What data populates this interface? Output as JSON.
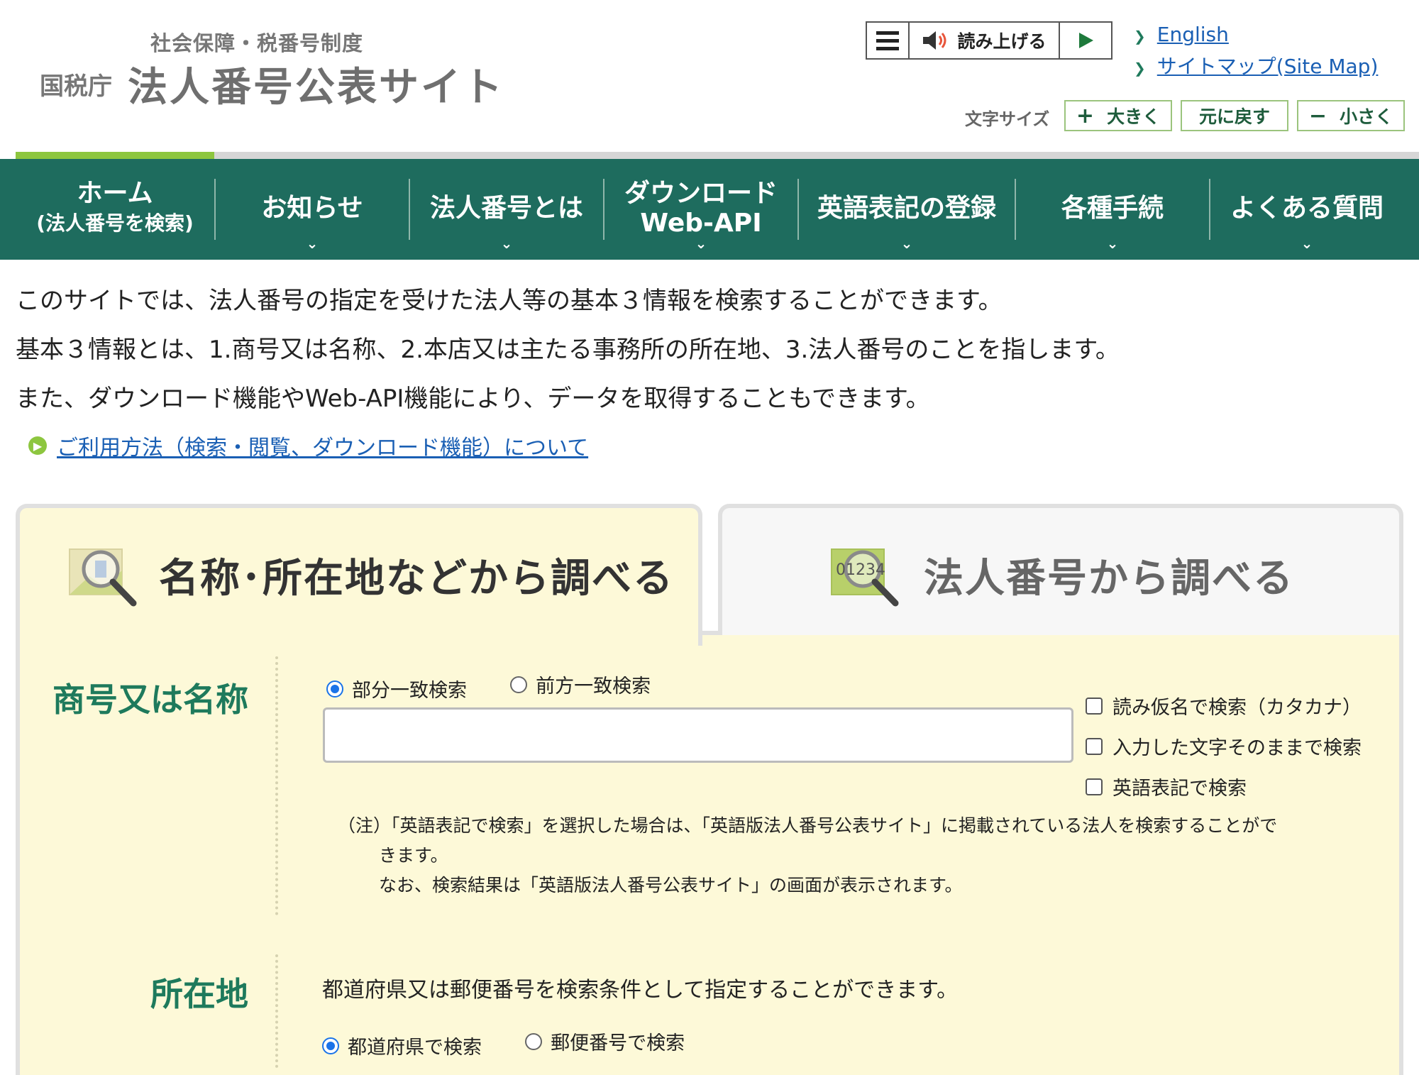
{
  "header": {
    "logo_sub": "社会保障・税番号制度",
    "logo_agency": "国税庁",
    "logo_title": "法人番号公表サイト",
    "readaloud_label": "読み上げる",
    "links": {
      "english": "English",
      "sitemap": "サイトマップ(Site Map)"
    },
    "fontsize": {
      "label": "文字サイズ",
      "larger": "大きく",
      "reset": "元に戻す",
      "smaller": "小さく"
    }
  },
  "nav": {
    "items": [
      {
        "line1": "ホーム",
        "line2": "(法人番号を検索)"
      },
      {
        "line1": "お知らせ"
      },
      {
        "line1": "法人番号とは"
      },
      {
        "line1": "ダウンロード",
        "line2": "Web-API"
      },
      {
        "line1": "英語表記の登録"
      },
      {
        "line1": "各種手続"
      },
      {
        "line1": "よくある質問"
      }
    ]
  },
  "intro": {
    "line1": "このサイトでは、法人番号の指定を受けた法人等の基本３情報を検索することができます。",
    "line2": "基本３情報とは、1.商号又は名称、2.本店又は主たる事務所の所在地、3.法人番号のことを指します。",
    "line3": "また、ダウンロード機能やWeb-API機能により、データを取得することもできます。",
    "usage_link": "ご利用方法（検索・閲覧、ダウンロード機能）について"
  },
  "tabs": {
    "name_search": "名称･所在地などから調べる",
    "number_search": "法人番号から調べる",
    "number_icon_text": "01234"
  },
  "form": {
    "name": {
      "label": "商号又は名称",
      "radio_partial": "部分一致検索",
      "radio_prefix": "前方一致検索",
      "input_value": "",
      "check_kana": "読み仮名で検索（カタカナ）",
      "check_exact": "入力した文字そのままで検索",
      "check_english": "英語表記で検索",
      "note_line1": "（注）「英語表記で検索」を選択した場合は、「英語版法人番号公表サイト」に掲載されている法人を検索することがで",
      "note_line2": "きます。",
      "note_line3": "なお、検索結果は「英語版法人番号公表サイト」の画面が表示されます。"
    },
    "address": {
      "label": "所在地",
      "description": "都道府県又は郵便番号を検索条件として指定することができます。",
      "radio_pref": "都道府県で検索",
      "radio_zip": "郵便番号で検索"
    }
  },
  "colors": {
    "nav_bg": "#1e6c5e",
    "accent_green": "#8dc63f",
    "panel_bg": "#fdf9d8",
    "label_green": "#1e7a5c",
    "link_blue": "#1a5fb4"
  }
}
